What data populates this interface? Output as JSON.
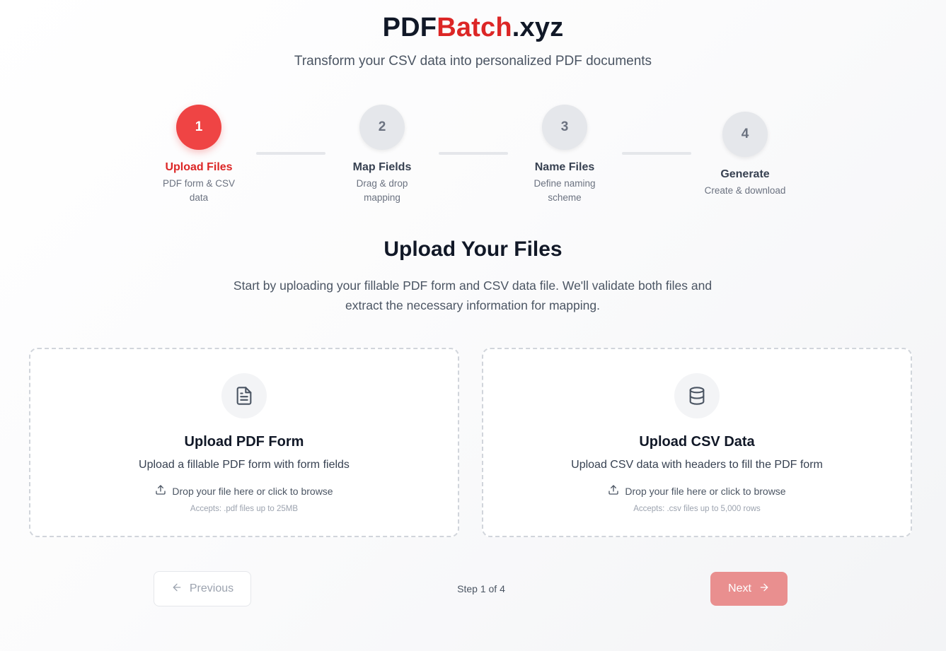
{
  "header": {
    "brand_part1": "PDF",
    "brand_part2": "Batch",
    "brand_part3": ".xyz",
    "tagline": "Transform your CSV data into personalized PDF documents"
  },
  "stepper": {
    "steps": [
      {
        "number": "1",
        "title": "Upload Files",
        "subtitle": "PDF form & CSV data",
        "state": "active"
      },
      {
        "number": "2",
        "title": "Map Fields",
        "subtitle": "Drag & drop mapping",
        "state": "inactive"
      },
      {
        "number": "3",
        "title": "Name Files",
        "subtitle": "Define naming scheme",
        "state": "inactive"
      },
      {
        "number": "4",
        "title": "Generate",
        "subtitle": "Create & download",
        "state": "inactive"
      }
    ]
  },
  "main": {
    "title": "Upload Your Files",
    "description": "Start by uploading your fillable PDF form and CSV data file. We'll validate both files and extract the necessary information for mapping."
  },
  "cards": {
    "pdf": {
      "icon": "file-text-icon",
      "title": "Upload PDF Form",
      "description": "Upload a fillable PDF form with form fields",
      "drop_text": "Drop your file here or click to browse",
      "accepts": "Accepts: .pdf files up to 25MB"
    },
    "csv": {
      "icon": "database-icon",
      "title": "Upload CSV Data",
      "description": "Upload CSV data with headers to fill the PDF form",
      "drop_text": "Drop your file here or click to browse",
      "accepts": "Accepts: .csv files up to 5,000 rows"
    }
  },
  "nav": {
    "previous_label": "Previous",
    "step_indicator": "Step 1 of 4",
    "next_label": "Next"
  },
  "colors": {
    "accent": "#ef4444",
    "accent_text": "#dc2626",
    "next_disabled": "#e98f8f"
  }
}
